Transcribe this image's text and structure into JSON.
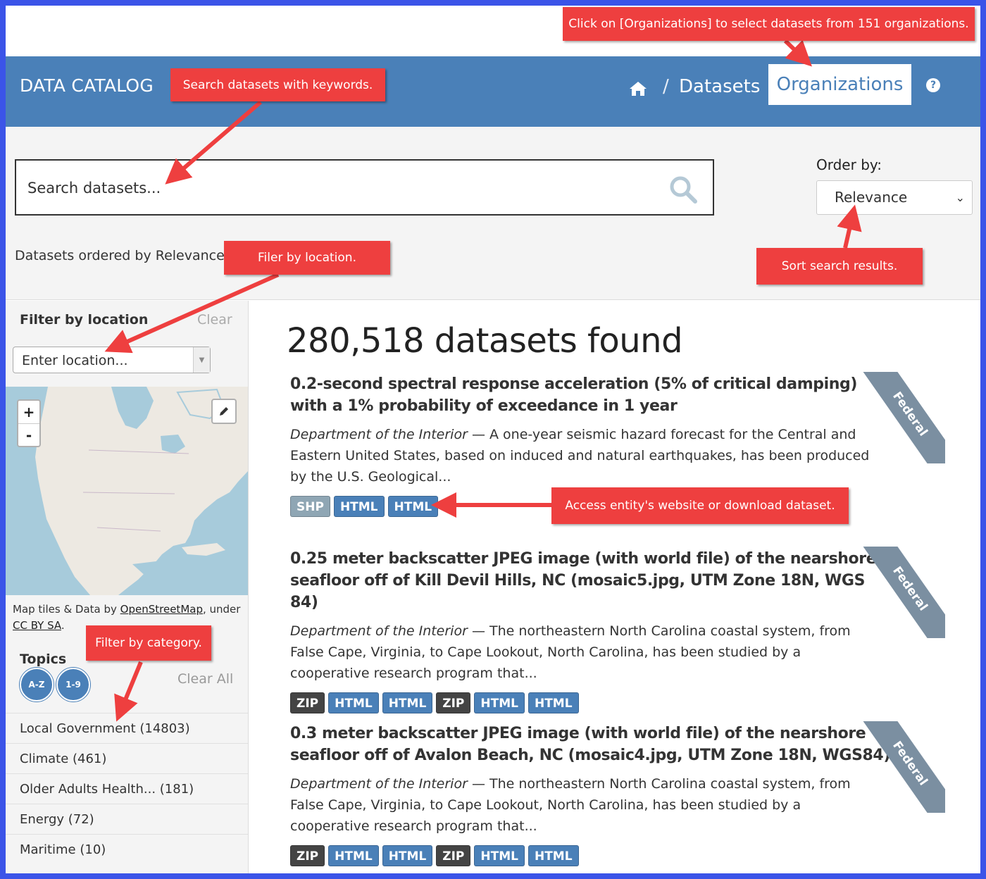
{
  "header": {
    "brand": "DATA CATALOG",
    "breadcrumb_sep": "/",
    "breadcrumb_datasets": "Datasets",
    "organizations_button": "Organizations",
    "help": "?"
  },
  "search": {
    "placeholder": "Search datasets...",
    "order_label": "Order by:",
    "order_value": "Relevance",
    "ordered_text": "Datasets ordered by Relevance"
  },
  "sidebar": {
    "filter_title": "Filter by location",
    "filter_clear": "Clear",
    "location_placeholder": "Enter location...",
    "zoom_in": "+",
    "zoom_out": "-",
    "attribution_prefix": "Map tiles & Data by ",
    "attribution_link1": "OpenStreetMap",
    "attribution_mid": ", under ",
    "attribution_link2": "CC BY SA",
    "attribution_end": ".",
    "topics_title": "Topics",
    "sort_az": "A-Z",
    "sort_19": "1-9",
    "topics_clear": "Clear All",
    "topics": [
      {
        "label": "Local Government (14803)"
      },
      {
        "label": "Climate (461)"
      },
      {
        "label": "Older Adults Health... (181)"
      },
      {
        "label": "Energy (72)"
      },
      {
        "label": "Maritime (10)"
      }
    ]
  },
  "results": {
    "count_text": "280,518 datasets found",
    "items": [
      {
        "title": "0.2-second spectral response acceleration (5% of critical damping) with a 1% probability of exceedance in 1 year",
        "org": "Department of the Interior",
        "desc": " — A one-year seismic hazard forecast for the Central and Eastern United States, based on induced and natural earthquakes, has been produced by the U.S. Geological...",
        "ribbon": "Federal",
        "formats": [
          "SHP",
          "HTML",
          "HTML"
        ]
      },
      {
        "title": "0.25 meter backscatter JPEG image (with world file) of the nearshore seafloor off of Kill Devil Hills, NC (mosaic5.jpg, UTM Zone 18N, WGS 84)",
        "org": "Department of the Interior",
        "desc": " — The northeastern North Carolina coastal system, from False Cape, Virginia, to Cape Lookout, North Carolina, has been studied by a cooperative research program that...",
        "ribbon": "Federal",
        "formats": [
          "ZIP",
          "HTML",
          "HTML",
          "ZIP",
          "HTML",
          "HTML"
        ]
      },
      {
        "title": "0.3 meter backscatter JPEG image (with world file) of the nearshore seafloor off of Avalon Beach, NC (mosaic4.jpg, UTM Zone 18N, WGS84)",
        "org": "Department of the Interior",
        "desc": " — The northeastern North Carolina coastal system, from False Cape, Virginia, to Cape Lookout, North Carolina, has been studied by a cooperative research program that...",
        "ribbon": "Federal",
        "formats": [
          "ZIP",
          "HTML",
          "HTML",
          "ZIP",
          "HTML",
          "HTML"
        ]
      }
    ]
  },
  "annotations": {
    "organizations": "Click on [Organizations] to select datasets from 151 organizations.",
    "search": "Search datasets with keywords.",
    "location": "Filer by location.",
    "sort": "Sort search results.",
    "access": "Access entity's website or download dataset.",
    "category": "Filter by category."
  },
  "colors": {
    "header_bg": "#4a80b8",
    "callout": "#ee3f3f",
    "frame": "#3b54e8",
    "ribbon": "#7b8fa1",
    "html_badge": "#4a80b8",
    "zip_badge": "#444444",
    "shp_badge": "#8fa6b4"
  },
  "icons": [
    "home-icon",
    "search-icon",
    "help-icon",
    "pencil-icon",
    "chevron-down-icon"
  ]
}
